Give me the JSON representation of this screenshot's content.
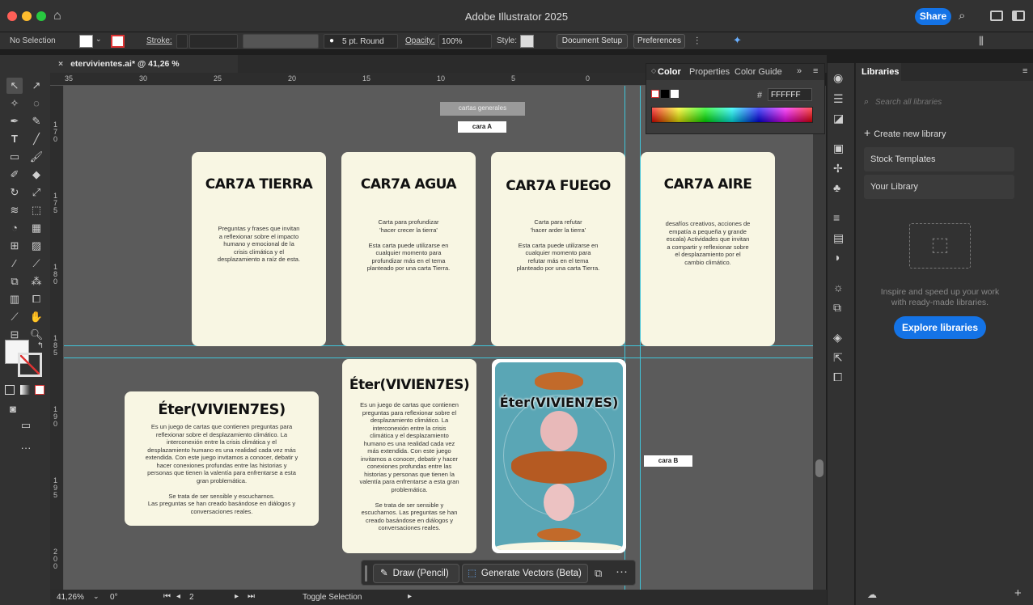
{
  "window": {
    "title": "Adobe Illustrator 2025",
    "share_label": "Share"
  },
  "controlbar": {
    "selection": "No Selection",
    "stroke_label": "Stroke:",
    "brush": "5 pt. Round",
    "opacity_label": "Opacity:",
    "opacity_value": "100%",
    "style_label": "Style:",
    "document_setup": "Document Setup",
    "preferences": "Preferences"
  },
  "document": {
    "tab_title": "etervivientes.ai* @ 41,26 % (CMYK/Preview)"
  },
  "rulers": {
    "horizontal": [
      "35",
      "30",
      "25",
      "20",
      "15",
      "10",
      "5",
      "0"
    ],
    "vertical": [
      "170",
      "175",
      "180",
      "185",
      "190",
      "195",
      "200"
    ]
  },
  "artboard": {
    "header_label": "cartas generales",
    "face_a_label": "cara A",
    "face_b_label": "cara B",
    "cards_top": [
      {
        "title": "CAR7A TIERRA",
        "lines": [
          "Preguntas y frases que invitan",
          "a reflexionar sobre el impacto",
          "humano y emocional de la",
          "crisis climática y el",
          "desplazamiento a raíz de esta."
        ]
      },
      {
        "title": "CAR7A AGUA",
        "lines": [
          "Carta para profundizar",
          "'hacer crecer la tierra'",
          "",
          "Esta carta puede utilizarse en",
          "cualquier momento para",
          "profundizar más en el tema",
          "planteado por una carta Tierra."
        ]
      },
      {
        "title": "CAR7A FUEGO",
        "lines": [
          "Carta para refutar",
          "'hacer arder la tierra'",
          "",
          "Esta carta puede utilizarse en",
          "cualquier momento para",
          "refutar más en el tema",
          "planteado por una carta Tierra."
        ]
      },
      {
        "title": "CAR7A AIRE",
        "lines": [
          "desafíos creativos, acciones de",
          "empatía a pequeña y grande",
          "escala) Actividades que invitan",
          "a compartir y reflexionar sobre",
          "el desplazamiento por el",
          "cambio climático."
        ]
      }
    ],
    "card_wide": {
      "title": "Éter(VIVIEN7ES)",
      "lines": [
        "Es un juego de cartas que contienen preguntas para",
        "reflexionar sobre el desplazamiento climático. La",
        "interconexión entre la crisis climática y el",
        "desplazamiento humano es una realidad cada vez más",
        "extendida. Con este juego invitamos a conocer, debatir y",
        "hacer conexiones profundas entre las historias y",
        "personas que tienen la valentía para enfrentarse a esta",
        "gran problemática.",
        "",
        "Se trata de ser sensible y escucharnos.",
        "Las preguntas se han creado basándose en diálogos y",
        "conversaciones reales."
      ]
    },
    "card_tall": {
      "title": "Éter(VIVIEN7ES)",
      "lines": [
        "Es un juego de cartas que contienen",
        "preguntas para reflexionar sobre el",
        "desplazamiento climático. La",
        "interconexión entre la crisis",
        "climática y el desplazamiento",
        "humano es una realidad cada vez",
        "más extendida. Con este juego",
        "invitamos a conocer, debatir y hacer",
        "conexiones profundas entre las",
        "historias y personas que tienen la",
        "valentía para enfrentarse a esta gran",
        "problemática.",
        "",
        "Se trata de ser sensible y",
        "escucharnos.  Las preguntas se han",
        "creado basándose en diálogos y",
        "conversaciones reales."
      ]
    },
    "card_art": {
      "title": "Éter(VIVIEN7ES)"
    }
  },
  "contextbar": {
    "draw_label": "Draw (Pencil)",
    "generate_label": "Generate Vectors (Beta)"
  },
  "color_panel": {
    "tabs": [
      "Color",
      "Properties",
      "Color Guide"
    ],
    "hex_label": "#",
    "hex_value": "FFFFFF"
  },
  "libraries": {
    "tab": "Libraries",
    "search_placeholder": "Search all libraries",
    "create": "Create new library",
    "items": [
      "Stock Templates",
      "Your Library"
    ],
    "empty_text_1": "Inspire and speed up your work",
    "empty_text_2": "with ready-made libraries.",
    "explore": "Explore libraries"
  },
  "status": {
    "zoom": "41,26%",
    "rotation": "0°",
    "artboard": "2",
    "tool": "Toggle Selection"
  },
  "colors": {
    "accent": "#1473e6",
    "guide": "#40c4d9",
    "card_bg": "#f8f6e3",
    "canvas": "#5b5b5b"
  }
}
